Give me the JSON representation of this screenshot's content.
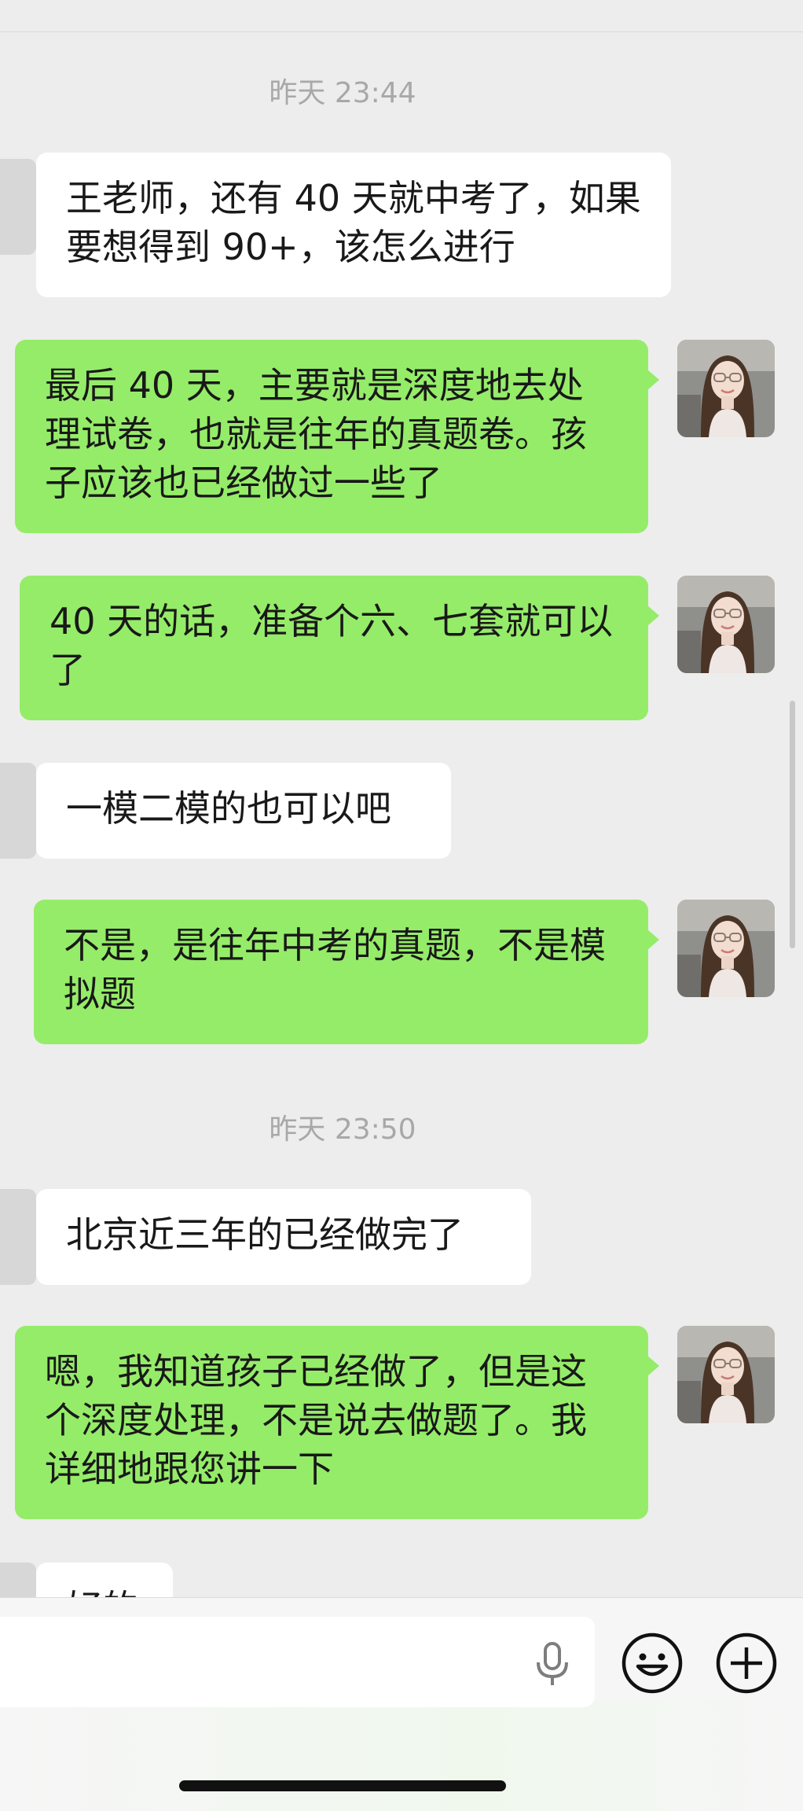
{
  "timestamps": [
    "昨天 23:44",
    "昨天 23:50"
  ],
  "messages": [
    {
      "sender": "other",
      "text": "王老师，还有 40 天就中考了，如果要想得到 90+，该怎么进行"
    },
    {
      "sender": "self",
      "text": "最后 40 天，主要就是深度地去处理试卷，也就是往年的真题卷。孩子应该也已经做过一些了"
    },
    {
      "sender": "self",
      "text": "40 天的话，准备个六、七套就可以了"
    },
    {
      "sender": "other",
      "text": "一模二模的也可以吧"
    },
    {
      "sender": "self",
      "text": "不是，是往年中考的真题，不是模拟题"
    },
    {
      "sender": "other",
      "text": "北京近三年的已经做完了"
    },
    {
      "sender": "self",
      "text": "嗯，我知道孩子已经做了，但是这个深度处理，不是说去做题了。我详细地跟您讲一下"
    },
    {
      "sender": "other",
      "text": "好的"
    }
  ],
  "icons": {
    "voice": "microphone-icon",
    "emoji": "smiley-icon",
    "more": "plus-circle-icon"
  },
  "colors": {
    "background": "#ededed",
    "incoming_bubble": "#ffffff",
    "outgoing_bubble": "#95ec69",
    "timestamp": "#a8a8a8"
  }
}
